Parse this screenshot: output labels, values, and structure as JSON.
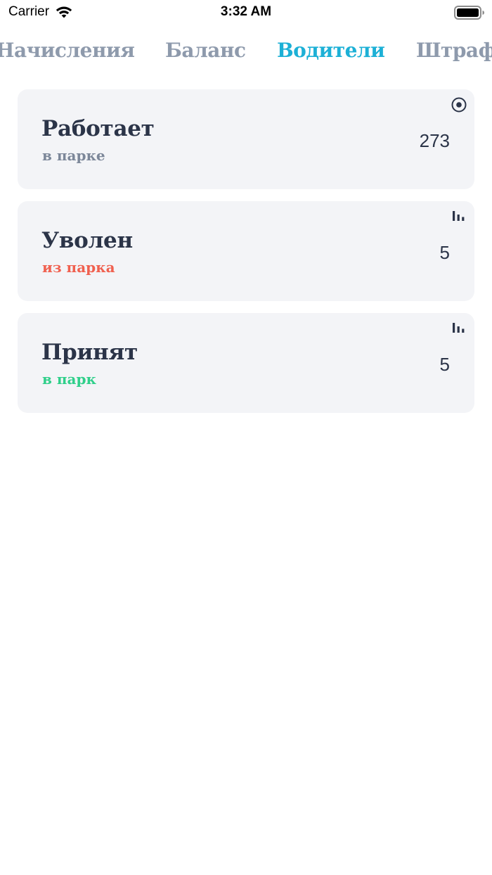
{
  "status_bar": {
    "carrier": "Carrier",
    "time": "3:32 AM"
  },
  "tabs": [
    {
      "label": "Начисления",
      "active": false
    },
    {
      "label": "Баланс",
      "active": false
    },
    {
      "label": "Водители",
      "active": true
    },
    {
      "label": "Штраф",
      "active": false
    }
  ],
  "cards": [
    {
      "title": "Работает",
      "subtitle": "в парке",
      "count": "273",
      "icon": "radio-target-icon",
      "subtitle_color": "#7c8799"
    },
    {
      "title": "Уволен",
      "subtitle": "из парка",
      "count": "5",
      "icon": "bar-chart-icon",
      "subtitle_color": "#f0604f"
    },
    {
      "title": "Принят",
      "subtitle": "в парк",
      "count": "5",
      "icon": "bar-chart-icon",
      "subtitle_color": "#2fcf8a"
    }
  ],
  "colors": {
    "accent": "#1cb0d6",
    "tab_inactive": "#8e9aac",
    "card_bg": "#f3f4f7",
    "text_dark": "#2b3448"
  }
}
